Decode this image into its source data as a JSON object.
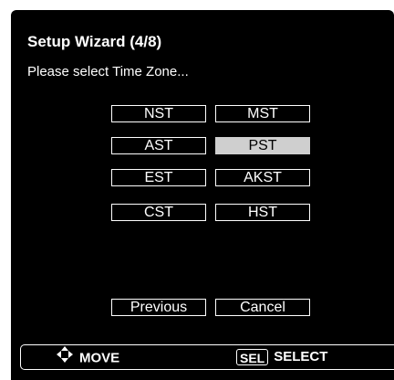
{
  "dialog": {
    "title": "Setup Wizard (4/8)",
    "prompt": "Please select Time Zone..."
  },
  "timezones": {
    "options": [
      "NST",
      "MST",
      "AST",
      "PST",
      "EST",
      "AKST",
      "CST",
      "HST"
    ],
    "selected": "PST"
  },
  "buttons": {
    "previous": "Previous",
    "cancel": "Cancel"
  },
  "footer": {
    "move_label": "MOVE",
    "sel_key": "SEL",
    "select_label": "SELECT",
    "move_icon": "four-way-arrows-icon"
  },
  "colors": {
    "background": "#000000",
    "text": "#ffffff",
    "selected_bg": "#cfcfcf"
  }
}
